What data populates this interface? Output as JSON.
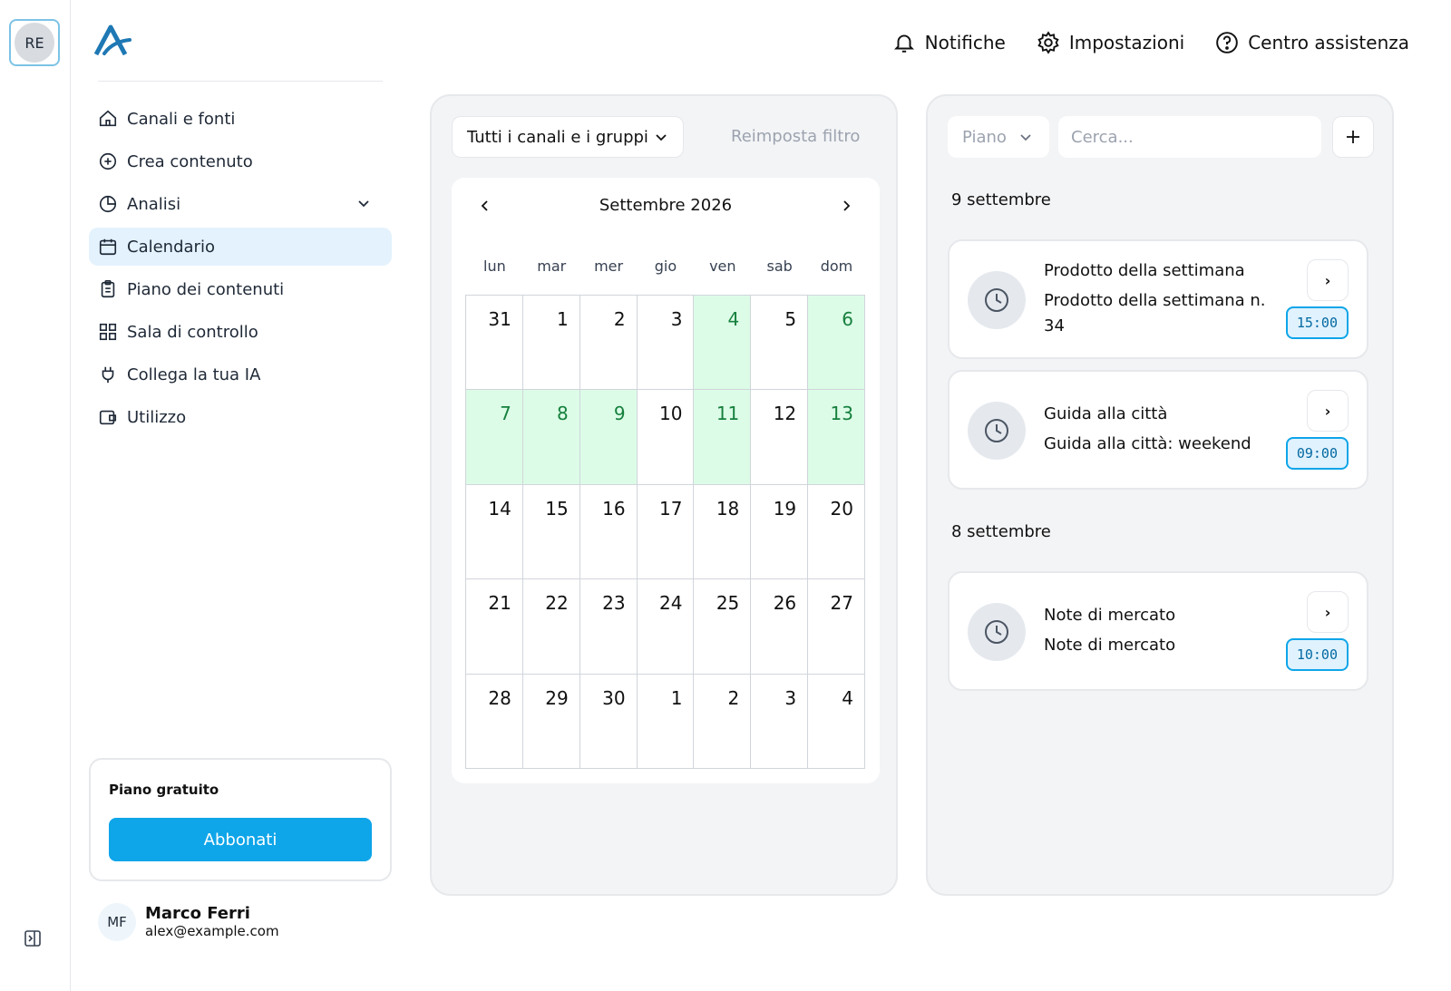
{
  "workspace": {
    "initials": "RE"
  },
  "nav": {
    "items": [
      {
        "label": "Canali e fonti",
        "icon": "home-icon"
      },
      {
        "label": "Crea contenuto",
        "icon": "plus-circle-icon"
      },
      {
        "label": "Analisi",
        "icon": "pie-chart-icon"
      },
      {
        "label": "Calendario",
        "icon": "calendar-icon",
        "active": true
      },
      {
        "label": "Piano dei contenuti",
        "icon": "clipboard-icon"
      },
      {
        "label": "Sala di controllo",
        "icon": "dashboard-icon"
      },
      {
        "label": "Collega la tua IA",
        "icon": "plug-icon"
      },
      {
        "label": "Utilizzo",
        "icon": "wallet-icon"
      }
    ]
  },
  "plan": {
    "title": "Piano gratuito",
    "button": "Abbonati"
  },
  "user": {
    "initials": "MF",
    "name": "Marco Ferri",
    "email": "alex@example.com"
  },
  "header": {
    "notifications": "Notifiche",
    "settings": "Impostazioni",
    "help": "Centro assistenza"
  },
  "calendar": {
    "channel_filter": "Tutti i canali e i gruppi",
    "reset": "Reimposta filtro",
    "month": "Settembre 2026",
    "weekdays": [
      "lun",
      "mar",
      "mer",
      "gio",
      "ven",
      "sab",
      "dom"
    ],
    "days": [
      {
        "d": "31",
        "hl": false
      },
      {
        "d": "1",
        "hl": false
      },
      {
        "d": "2",
        "hl": false
      },
      {
        "d": "3",
        "hl": false
      },
      {
        "d": "4",
        "hl": true
      },
      {
        "d": "5",
        "hl": false
      },
      {
        "d": "6",
        "hl": true
      },
      {
        "d": "7",
        "hl": true
      },
      {
        "d": "8",
        "hl": true
      },
      {
        "d": "9",
        "hl": true
      },
      {
        "d": "10",
        "hl": false
      },
      {
        "d": "11",
        "hl": true
      },
      {
        "d": "12",
        "hl": false
      },
      {
        "d": "13",
        "hl": true
      },
      {
        "d": "14",
        "hl": false
      },
      {
        "d": "15",
        "hl": false
      },
      {
        "d": "16",
        "hl": false
      },
      {
        "d": "17",
        "hl": false
      },
      {
        "d": "18",
        "hl": false
      },
      {
        "d": "19",
        "hl": false
      },
      {
        "d": "20",
        "hl": false
      },
      {
        "d": "21",
        "hl": false
      },
      {
        "d": "22",
        "hl": false
      },
      {
        "d": "23",
        "hl": false
      },
      {
        "d": "24",
        "hl": false
      },
      {
        "d": "25",
        "hl": false
      },
      {
        "d": "26",
        "hl": false
      },
      {
        "d": "27",
        "hl": false
      },
      {
        "d": "28",
        "hl": false
      },
      {
        "d": "29",
        "hl": false
      },
      {
        "d": "30",
        "hl": false
      },
      {
        "d": "1",
        "hl": false
      },
      {
        "d": "2",
        "hl": false
      },
      {
        "d": "3",
        "hl": false
      },
      {
        "d": "4",
        "hl": false
      }
    ],
    "highlight_color": "#dcfce7"
  },
  "posts": {
    "plan_select": "Piano",
    "search_placeholder": "Cerca...",
    "groups": [
      {
        "date": "9 settembre",
        "items": [
          {
            "title": "Prodotto della settimana",
            "desc": "Prodotto della settimana n. 34",
            "time": "15:00"
          },
          {
            "title": "Guida alla città",
            "desc": "Guida alla città: weekend",
            "time": "09:00"
          }
        ]
      },
      {
        "date": "8 settembre",
        "items": [
          {
            "title": "Note di mercato",
            "desc": "Note di mercato",
            "time": "10:00"
          }
        ]
      }
    ],
    "accent": "#0ea5e9"
  }
}
